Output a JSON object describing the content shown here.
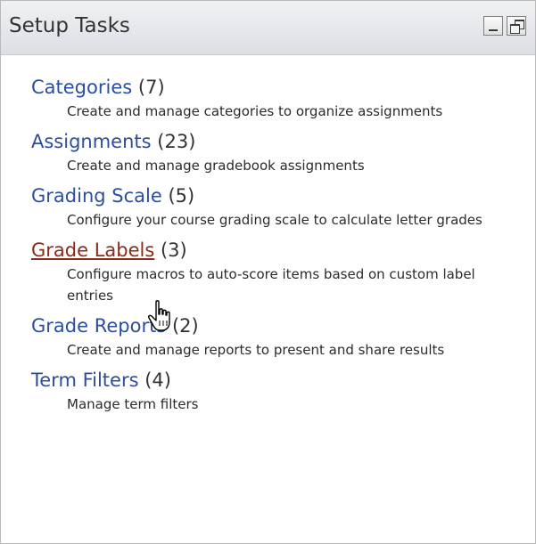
{
  "panel": {
    "title": "Setup Tasks",
    "controls": [
      {
        "name": "minimize",
        "icon": "minimize-icon"
      },
      {
        "name": "restore",
        "icon": "restore-icon"
      }
    ]
  },
  "tasks": [
    {
      "label": "Categories",
      "count": "(7)",
      "description": "Create and manage categories to organize assignments"
    },
    {
      "label": "Assignments",
      "count": "(23)",
      "description": "Create and manage gradebook assignments"
    },
    {
      "label": "Grading Scale",
      "count": "(5)",
      "description": "Configure your course grading scale to calculate letter grades"
    },
    {
      "label": "Grade Labels",
      "count": "(3)",
      "description": "Configure macros to auto-score items based on custom label entries"
    },
    {
      "label": "Grade Reports",
      "count": "(2)",
      "description": "Create and manage reports to present and share results"
    },
    {
      "label": "Term Filters",
      "count": "(4)",
      "description": "Manage term filters"
    }
  ],
  "state": {
    "hovered_task": "Grade Labels",
    "cursor_icon": "hand-pointer-icon"
  },
  "colors": {
    "link": "#2c4e9e",
    "link_hover": "#8b2a1a",
    "header_bg": "#e3e6ea",
    "text": "#2b2b2b"
  }
}
